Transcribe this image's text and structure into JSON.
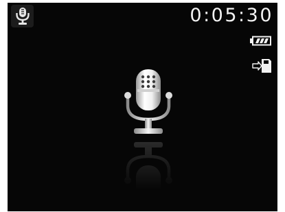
{
  "mode": {
    "icon": "microphone-icon",
    "name": "voice-recording"
  },
  "status": {
    "elapsed_time": "0:05:30",
    "battery_icon": "battery-full-icon",
    "battery_level": 1.0,
    "storage_icon": "memory-card-icon"
  },
  "main": {
    "icon": "studio-microphone-icon"
  },
  "colors": {
    "screen_background": "#060606",
    "text": "#f2f2f2",
    "badge_background": "#1c1c1c"
  }
}
